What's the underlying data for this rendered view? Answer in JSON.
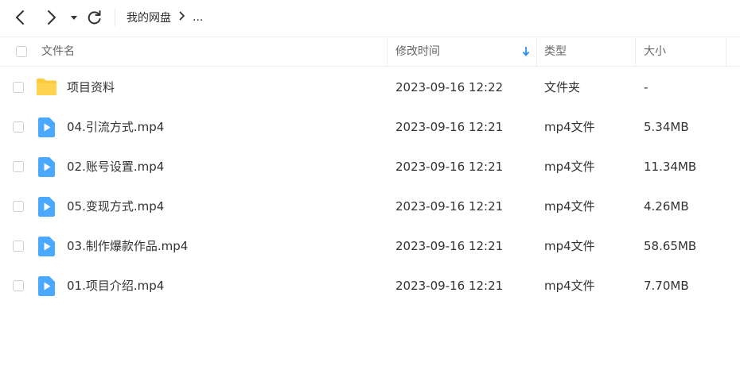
{
  "toolbar": {
    "breadcrumb_root": "我的网盘",
    "breadcrumb_more": "..."
  },
  "columns": {
    "name": "文件名",
    "modified": "修改时间",
    "type": "类型",
    "size": "大小"
  },
  "files": [
    {
      "name": "项目资料",
      "modified": "2023-09-16 12:22",
      "type": "文件夹",
      "size": "-",
      "icon": "folder-icon"
    },
    {
      "name": "04.引流方式.mp4",
      "modified": "2023-09-16 12:21",
      "type": "mp4文件",
      "size": "5.34MB",
      "icon": "video-file-icon"
    },
    {
      "name": "02.账号设置.mp4",
      "modified": "2023-09-16 12:21",
      "type": "mp4文件",
      "size": "11.34MB",
      "icon": "video-file-icon"
    },
    {
      "name": "05.变现方式.mp4",
      "modified": "2023-09-16 12:21",
      "type": "mp4文件",
      "size": "4.26MB",
      "icon": "video-file-icon"
    },
    {
      "name": "03.制作爆款作品.mp4",
      "modified": "2023-09-16 12:21",
      "type": "mp4文件",
      "size": "58.65MB",
      "icon": "video-file-icon"
    },
    {
      "name": "01.项目介绍.mp4",
      "modified": "2023-09-16 12:21",
      "type": "mp4文件",
      "size": "7.70MB",
      "icon": "video-file-icon"
    }
  ],
  "colors": {
    "folder": "#ffc93c",
    "video_file": "#4aa9ff",
    "sort_arrow": "#2b8cf5"
  }
}
